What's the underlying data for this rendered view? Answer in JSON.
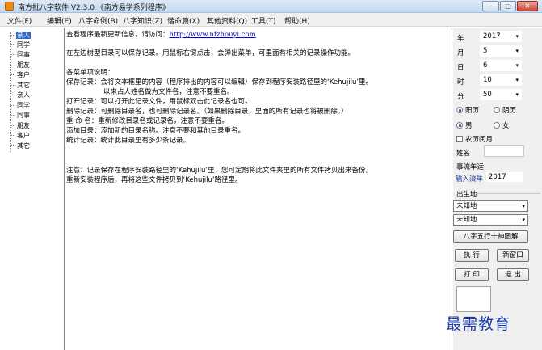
{
  "window": {
    "title": "南方批八字软件 V2.3.0 《南方易学系列程序》",
    "min_symbol": "–",
    "max_symbol": "□",
    "close_symbol": "✕"
  },
  "menu": [
    "文件(F)",
    "编辑(E)",
    "八字命例(B)",
    "八字知识(Z)",
    "谐命篇(X)",
    "其他资料(Q)",
    "工具(T)",
    "帮助(H)"
  ],
  "tree": {
    "items": [
      "亲人",
      "同学",
      "同事",
      "朋友",
      "客户",
      "其它",
      "亲人",
      "同学",
      "同事",
      "朋友",
      "客户",
      "其它"
    ],
    "selected_index": 0
  },
  "text": {
    "line1_prefix": "查看程序最新更新信息，请访问：",
    "line1_link": "http://www.nfzhouyi.com",
    "line2": "在左边树型目录可以保存记录。用鼠标右键点击，会弹出菜单，可里面有相关的记录操作功能。",
    "line3": "各菜单项说明：",
    "line4": "保存记录：会将文本框里的内容（程序排出的内容可以编辑）保存到程序安装路径里的‘Kehujilu’里。",
    "line5": "以来占人姓名做为文件名，注意不要重名。",
    "line6": "打开记录：可以打开此记录文件，用鼠标双击此记录名也可。",
    "line7": "删除记录：可删除目录名，也可删除记录名。（如果删除目录，里面的所有记录也将被删除。）",
    "line8": "重 命 名：重新修改目录名或记录名，注意不要重名。",
    "line9": "添加目录：添加新的目录名称。注意不要和其他目录重名。",
    "line10": "统计记录：统计此目录里有多少条记录。",
    "line11": "注意：记录保存在程序安装路径里的‘Kehujilu’里，您可定期将此文件夹里的所有文件拷贝出来备份。",
    "line12": "重新安装程序后，再将这些文件拷贝到‘Kehujilu’路径里。"
  },
  "panel": {
    "year_label": "年",
    "year_value": "2017",
    "month_label": "月",
    "month_value": "5",
    "day_label": "日",
    "day_value": "6",
    "hour_label": "时",
    "hour_value": "10",
    "minute_label": "分",
    "minute_value": "50",
    "solar_label": "阳历",
    "lunar_label": "阴历",
    "male_label": "男",
    "female_label": "女",
    "leap_label": "农历闰月",
    "name_label": "姓名",
    "name_value": "",
    "luck_label": "事流年运",
    "flow_year_label": "输入流年",
    "flow_year_value": "2017",
    "birthplace_label": "出生地",
    "birthplace1": "未知地",
    "birthplace2": "未知地",
    "chart_button": "八字五行十神图解",
    "run_button": "执 行",
    "newwin_button": "新窗口",
    "print_button": "打 印",
    "exit_button": "退 出",
    "dropdown_arrow": "▾"
  },
  "watermark": "最需教育",
  "colors": {
    "selection": "#3169c6",
    "link": "#0000cc",
    "watermark": "#1a3aa8"
  }
}
